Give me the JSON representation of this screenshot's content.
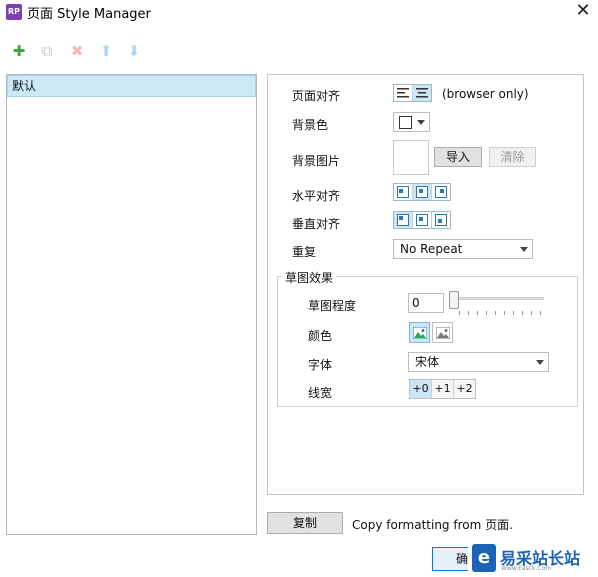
{
  "window": {
    "app_icon_text": "RP",
    "title": "页面 Style Manager",
    "close_glyph": "✕"
  },
  "toolbar": {
    "add": "✚",
    "duplicate": "⧉",
    "delete": "✖",
    "move_up": "⬆",
    "move_down": "⬇",
    "colors": {
      "add": "#3aa53a",
      "disabled": "#c9c9c9",
      "delete_disabled": "#f2b8b8",
      "arrow_disabled": "#b7d3ea"
    }
  },
  "styles_list": {
    "items": [
      "默认"
    ]
  },
  "page_align": {
    "label": "页面对齐",
    "note": "(browser only)"
  },
  "background_color": {
    "label": "背景色",
    "value": "#ffffff"
  },
  "background_image": {
    "label": "背景图片",
    "import_label": "导入",
    "clear_label": "清除"
  },
  "horizontal_align": {
    "label": "水平对齐",
    "selected_index": 1
  },
  "vertical_align": {
    "label": "垂直对齐",
    "selected_index": 0
  },
  "repeat": {
    "label": "重复",
    "value": "No Repeat"
  },
  "sketch": {
    "group_label": "草图效果",
    "degree_label": "草图程度",
    "degree_value": "0",
    "color_label": "颜色",
    "color_selected_index": 0,
    "font_label": "字体",
    "font_value": "宋体",
    "line_width_label": "线宽",
    "line_width_options": [
      "+0",
      "+1",
      "+2"
    ],
    "line_width_selected_index": 0
  },
  "footer": {
    "copy_label": "复制",
    "copy_text": "Copy formatting from 页面.",
    "ok_label": "确"
  },
  "watermark": {
    "text": "易采站长站",
    "logo_text": "e",
    "sub": "Www.Easck.Com"
  }
}
